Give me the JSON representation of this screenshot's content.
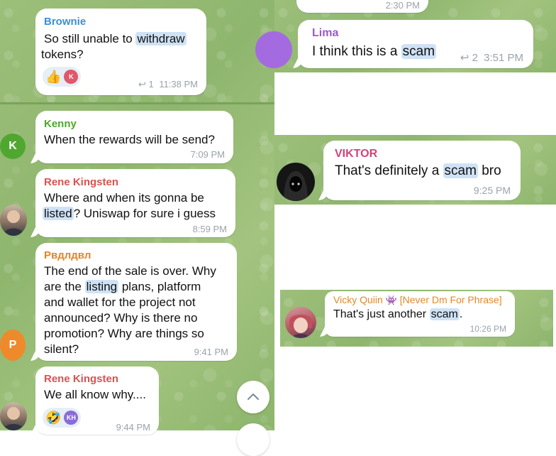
{
  "left": {
    "brownie": {
      "sender": "Brownie",
      "text_before": "So still unable to ",
      "highlight": "withdraw",
      "text_after": " tokens?",
      "reaction_emoji": "👍",
      "reaction_user": "K",
      "reply_count": "↩ 1",
      "time": "11:38 PM"
    },
    "kenny": {
      "sender": "Kenny",
      "avatar": "K",
      "text": "When the rewards will be send?",
      "time": "7:09 PM"
    },
    "rene1": {
      "sender": "Rene Kingsten",
      "line1": "Where and when its gonna be",
      "highlight": "listed",
      "after": "? Uniswap for sure i guess",
      "time": "8:59 PM"
    },
    "user_p": {
      "sender": "Рвдлдвл",
      "avatar": "P",
      "line1": "The end of the sale is over. Why",
      "line2_before": "are the ",
      "line2_highlight": "listing",
      "line2_after": " plans, platform",
      "line3": "and wallet for the project not",
      "line4": "announced? Why is there no",
      "line5": "promotion? Why are things so",
      "line6": "silent?",
      "time": "9:41 PM"
    },
    "rene2": {
      "sender": "Rene Kingsten",
      "text": "We all know why....",
      "reaction_emoji": "🤣",
      "reaction_user": "KH",
      "time": "9:44 PM"
    }
  },
  "right": {
    "top_time": "2:30 PM",
    "lima": {
      "sender": "Lima",
      "text_before": "I think this is a ",
      "highlight": "scam",
      "reply_count": "↩ 2",
      "time": "3:51 PM"
    },
    "viktor": {
      "sender": "VIKTOR",
      "text_before": "That's definitely a ",
      "highlight": "scam",
      "text_after": " bro",
      "time": "9:25 PM"
    },
    "vicky": {
      "sender_name": "Vicky Quiin",
      "sender_badge": "👾",
      "sender_tag": "[Never Dm For Phrase]",
      "text_before": "That's just another ",
      "highlight": "scam",
      "text_after": ".",
      "time": "10:26 PM"
    }
  },
  "colors": {
    "bg_green": "#93b972",
    "brownie": "#3c8fd4",
    "kenny": "#4fa72f",
    "rene": "#d9534f",
    "user_p": "#e0852b",
    "lima": "#9b59d0",
    "viktor": "#d0457a",
    "vicky": "#e08a2a",
    "highlight": "#cfe2f5"
  },
  "icons": {
    "scroll_down": "chevron-up-icon",
    "reply": "reply-arrow-icon"
  }
}
